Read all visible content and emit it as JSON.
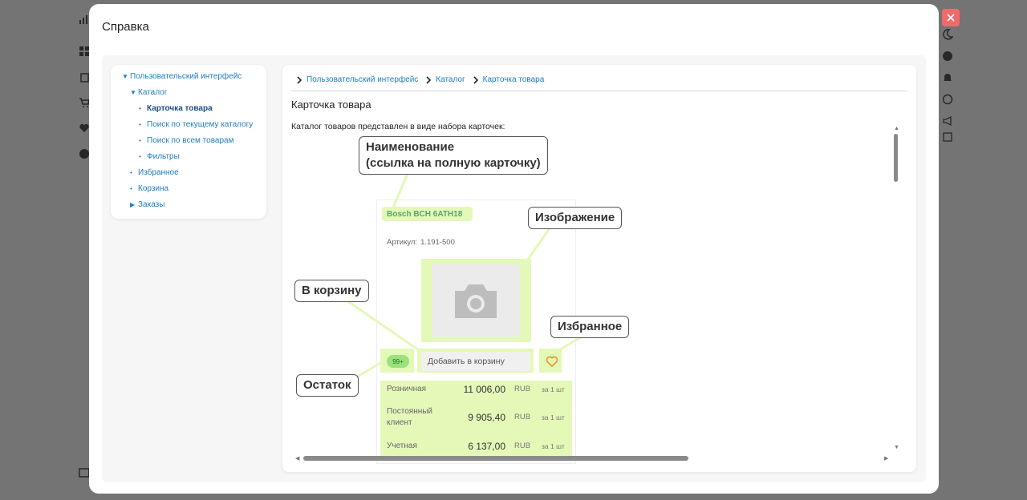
{
  "modal": {
    "title": "Справка"
  },
  "tree": [
    {
      "label": "Пользовательский интерфейс",
      "level": 0,
      "type": "expanded",
      "active": false
    },
    {
      "label": "Каталог",
      "level": 1,
      "type": "expanded",
      "active": false
    },
    {
      "label": "Карточка товара",
      "level": 2,
      "type": "leaf",
      "active": true
    },
    {
      "label": "Поиск по текущему каталогу",
      "level": 2,
      "type": "leaf",
      "active": false
    },
    {
      "label": "Поиск по всем товарам",
      "level": 2,
      "type": "leaf",
      "active": false
    },
    {
      "label": "Фильтры",
      "level": 2,
      "type": "leaf",
      "active": false
    },
    {
      "label": "Избранное",
      "level": 1,
      "type": "leaf",
      "active": false
    },
    {
      "label": "Корзина",
      "level": 1,
      "type": "leaf",
      "active": false
    },
    {
      "label": "Заказы",
      "level": 1,
      "type": "collapsed",
      "active": false
    }
  ],
  "breadcrumb": [
    "Пользовательский интерфейс",
    "Каталог",
    "Карточка товара"
  ],
  "article": {
    "title": "Карточка товара",
    "intro": "Каталог товаров представлен в виде набора карточек:"
  },
  "card": {
    "name": "Bosch BCH 6ATH18",
    "article_label": "Артикул:",
    "article_value": "1.191-500",
    "stock_badge": "99+",
    "add_to_cart": "Добавить в корзину",
    "prices": [
      {
        "label": "Розничная",
        "value": "11 006,00",
        "currency": "RUB",
        "unit": "за 1 шт"
      },
      {
        "label": "Постоянный клиент",
        "value": "9 905,40",
        "currency": "RUB",
        "unit": "за 1 шт"
      },
      {
        "label": "Учетная",
        "value": "6 137,00",
        "currency": "RUB",
        "unit": "за 1 шт"
      }
    ]
  },
  "callouts": {
    "name_line1": "Наименование",
    "name_line2": "(ссылка на полную карточку)",
    "image": "Изображение",
    "cart": "В корзину",
    "favorite": "Избранное",
    "stock": "Остаток"
  },
  "colors": {
    "link": "#1e7cc2",
    "highlight": "#e4f8b8",
    "close": "#f06a6a"
  }
}
